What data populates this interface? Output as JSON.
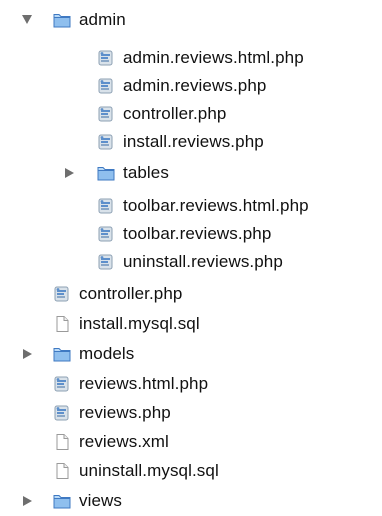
{
  "tree": {
    "items": [
      {
        "label": "admin",
        "type": "folder",
        "expanded": true,
        "depth": 0
      },
      {
        "label": "admin.reviews.html.php",
        "type": "php",
        "depth": 1
      },
      {
        "label": "admin.reviews.php",
        "type": "php",
        "depth": 1
      },
      {
        "label": "controller.php",
        "type": "php",
        "depth": 1
      },
      {
        "label": "install.reviews.php",
        "type": "php",
        "depth": 1
      },
      {
        "label": "tables",
        "type": "folder",
        "expanded": false,
        "depth": 1
      },
      {
        "label": "toolbar.reviews.html.php",
        "type": "php",
        "depth": 1
      },
      {
        "label": "toolbar.reviews.php",
        "type": "php",
        "depth": 1
      },
      {
        "label": "uninstall.reviews.php",
        "type": "php",
        "depth": 1
      },
      {
        "label": "controller.php",
        "type": "php",
        "depth": 0
      },
      {
        "label": "install.mysql.sql",
        "type": "doc",
        "depth": 0
      },
      {
        "label": "models",
        "type": "folder",
        "expanded": false,
        "depth": 0
      },
      {
        "label": "reviews.html.php",
        "type": "php",
        "depth": 0
      },
      {
        "label": "reviews.php",
        "type": "php",
        "depth": 0
      },
      {
        "label": "reviews.xml",
        "type": "doc",
        "depth": 0
      },
      {
        "label": "uninstall.mysql.sql",
        "type": "doc",
        "depth": 0
      },
      {
        "label": "views",
        "type": "folder",
        "expanded": false,
        "depth": 0
      }
    ]
  },
  "icons": {
    "folder": "folder-icon",
    "php": "php-file-icon",
    "doc": "document-icon",
    "expanded": "disclosure-triangle-down-icon",
    "collapsed": "disclosure-triangle-right-icon"
  },
  "colors": {
    "folder_fill": "#9cc7f1",
    "folder_stroke": "#3f79c2",
    "triangle": "#6e6e6e",
    "php_blue": "#5d8fcb",
    "php_gray": "#c9d2db"
  }
}
